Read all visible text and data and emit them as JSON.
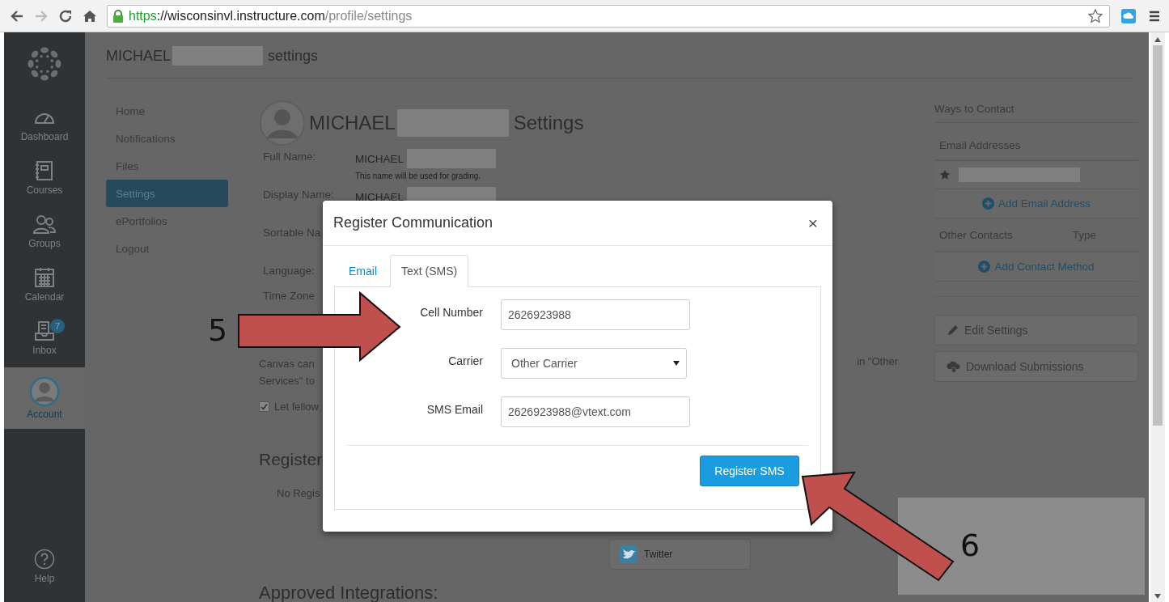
{
  "browser": {
    "url_scheme": "https",
    "url_host": "://wisconsinvl.instructure.com",
    "url_path": "/profile/settings"
  },
  "global_nav": {
    "items": [
      {
        "kind": "dashboard",
        "label": "Dashboard",
        "selected": false
      },
      {
        "kind": "courses",
        "label": "Courses",
        "selected": false
      },
      {
        "kind": "groups",
        "label": "Groups",
        "selected": false
      },
      {
        "kind": "calendar",
        "label": "Calendar",
        "selected": false
      },
      {
        "kind": "inbox",
        "label": "Inbox",
        "badge": "7",
        "selected": false
      },
      {
        "kind": "account",
        "label": "Account",
        "selected": true
      }
    ],
    "help": "Help"
  },
  "page_header": {
    "name": "MICHAEL",
    "suffix": "settings"
  },
  "profile_nav": {
    "items": [
      {
        "label": "Home",
        "selected": false
      },
      {
        "label": "Notifications",
        "selected": false
      },
      {
        "label": "Files",
        "selected": false
      },
      {
        "label": "Settings",
        "selected": true
      },
      {
        "label": "ePortfolios",
        "selected": false
      },
      {
        "label": "Logout",
        "selected": false
      }
    ]
  },
  "profile": {
    "name": "MICHAEL",
    "suffix": "Settings",
    "fields": [
      {
        "label": "Full Name:",
        "value": "MICHAEL",
        "hint": "This name will be used for grading."
      },
      {
        "label": "Display Name:",
        "value": "MICHAEL"
      },
      {
        "label": "Sortable Na"
      },
      {
        "label": "Language:"
      },
      {
        "label": "Time Zone"
      }
    ],
    "notice_left": [
      "Canvas can",
      "Services\" to"
    ],
    "notice_right": "in \"Other",
    "checkbox": {
      "label": "Let fellow",
      "checked": true
    },
    "registered_heading": "Register",
    "registered_empty": "No Regis",
    "service_buttons": [
      {
        "label": "Twitter"
      }
    ],
    "integrations_heading": "Approved Integrations:"
  },
  "contact_panel": {
    "title": "Ways to Contact",
    "email_heading": "Email Addresses",
    "add_email": "Add Email Address",
    "other_heading": "Other Contacts",
    "type_heading": "Type",
    "add_contact": "Add Contact Method",
    "actions": [
      {
        "kind": "edit",
        "label": "Edit Settings"
      },
      {
        "kind": "download",
        "label": "Download Submissions"
      }
    ]
  },
  "dialog": {
    "title": "Register Communication",
    "close": "×",
    "tabs": [
      {
        "label": "Email",
        "selected": false
      },
      {
        "label": "Text (SMS)",
        "selected": true
      }
    ],
    "fields": [
      {
        "kind": "input",
        "label": "Cell Number",
        "value": "2626923988"
      },
      {
        "kind": "select",
        "label": "Carrier",
        "value": "Other Carrier"
      },
      {
        "kind": "input",
        "label": "SMS Email",
        "value": "2626923988@vtext.com"
      }
    ],
    "submit": "Register SMS"
  },
  "annotations": [
    {
      "kind": "arrow-right",
      "label": "5"
    },
    {
      "kind": "arrow-up-left",
      "label": "6"
    }
  ]
}
